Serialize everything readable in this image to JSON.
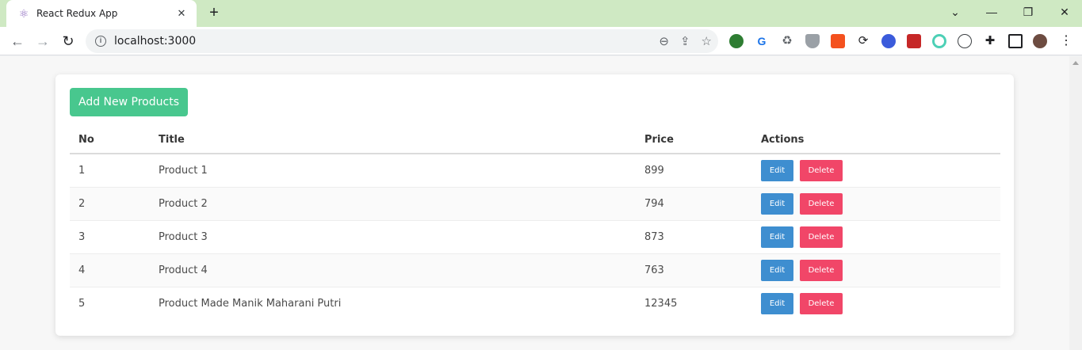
{
  "browser": {
    "tab_title": "React Redux App",
    "url": "localhost:3000",
    "accent": "#cfe9c3"
  },
  "page": {
    "add_button_label": "Add New Products",
    "columns": [
      "No",
      "Title",
      "Price",
      "Actions"
    ],
    "rows": [
      {
        "no": "1",
        "title": "Product 1",
        "price": "899",
        "edit": "Edit",
        "delete": "Delete"
      },
      {
        "no": "2",
        "title": "Product 2",
        "price": "794",
        "edit": "Edit",
        "delete": "Delete"
      },
      {
        "no": "3",
        "title": "Product 3",
        "price": "873",
        "edit": "Edit",
        "delete": "Delete"
      },
      {
        "no": "4",
        "title": "Product 4",
        "price": "763",
        "edit": "Edit",
        "delete": "Delete"
      },
      {
        "no": "5",
        "title": "Product Made Manik Maharani Putri",
        "price": "12345",
        "edit": "Edit",
        "delete": "Delete"
      }
    ],
    "colors": {
      "primary_success": "#48c78e",
      "edit": "#3e8ed0",
      "delete": "#f14668"
    }
  }
}
